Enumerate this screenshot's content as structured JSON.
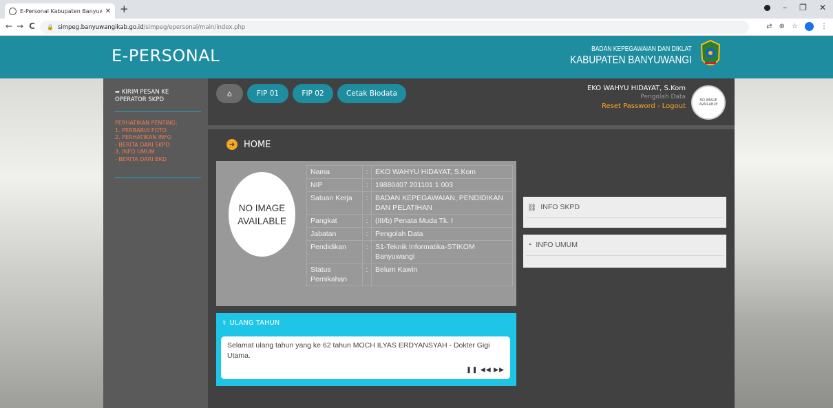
{
  "browser": {
    "tab_title": "E-Personal Kabupaten Banyuwangi",
    "new_tab": "+",
    "url_host": "simpeg.banyuwangikab.go.id",
    "url_path": "/simpeg/epersonal/main/index.php",
    "nav_back": "←",
    "nav_forward": "→",
    "nav_reload": "C"
  },
  "header": {
    "brand": "E-PERSONAL",
    "agency_line1": "BADAN KEPEGAWAIAN DAN DIKLAT",
    "agency_line2": "KABUPATEN BANYUWANGI"
  },
  "sidebar": {
    "message": "KIRIM PESAN KE OPERATOR SKPD",
    "notice": [
      "PERHATIKAN PENTING:",
      "1. PERBARUI FOTO",
      "2. PERHATIKAN INFO",
      "- BERITA DARI SKPD",
      "3. INFO UMUM",
      "- BERITA DARI BKD"
    ]
  },
  "toolbar": {
    "fip1": "FIP 01",
    "fip2": "FIP 02",
    "cetak": "Cetak Biodata"
  },
  "user": {
    "name": "EKO WAHYU HIDAYAT, S.Kom",
    "role": "Pengolah Data",
    "reset": "Reset Password",
    "sep": " - ",
    "logout": "Logout",
    "avatar_text": "NO IMAGE AVAILABLE"
  },
  "main": {
    "title": "HOME",
    "photo_text": "NO IMAGE AVAILABLE",
    "profile": [
      {
        "label": "Nama",
        "value": "EKO WAHYU HIDAYAT, S.Kom"
      },
      {
        "label": "NIP",
        "value": "19880407 201101 1 003"
      },
      {
        "label": "Satuan Kerja",
        "value": "BADAN KEPEGAWAIAN, PENDIDIKAN DAN PELATIHAN"
      },
      {
        "label": "Pangkat",
        "value": "(III/b) Penata Muda Tk. I"
      },
      {
        "label": "Jabatan",
        "value": "Pengolah Data"
      },
      {
        "label": "Pendidikan",
        "value": "S1-Teknik Informatika-STIKOM Banyuwangi"
      },
      {
        "label": "Status Pernikahan",
        "value": "Belum Kawin"
      }
    ],
    "colon": ":"
  },
  "panels": {
    "skpd": "INFO SKPD",
    "umum": "INFO UMUM"
  },
  "birthday": {
    "title": "ULANG TAHUN",
    "message": "Selamat ulang tahun yang ke 62 tahun MOCH ILYAS ERDYANSYAH - Dokter Gigi Utama.",
    "controls": "❚❚ ◀◀ ▶▶"
  },
  "colors": {
    "header": "#1e8da0",
    "accent": "#1ec5e6",
    "warning": "#f07c50",
    "link": "#ffa726"
  }
}
